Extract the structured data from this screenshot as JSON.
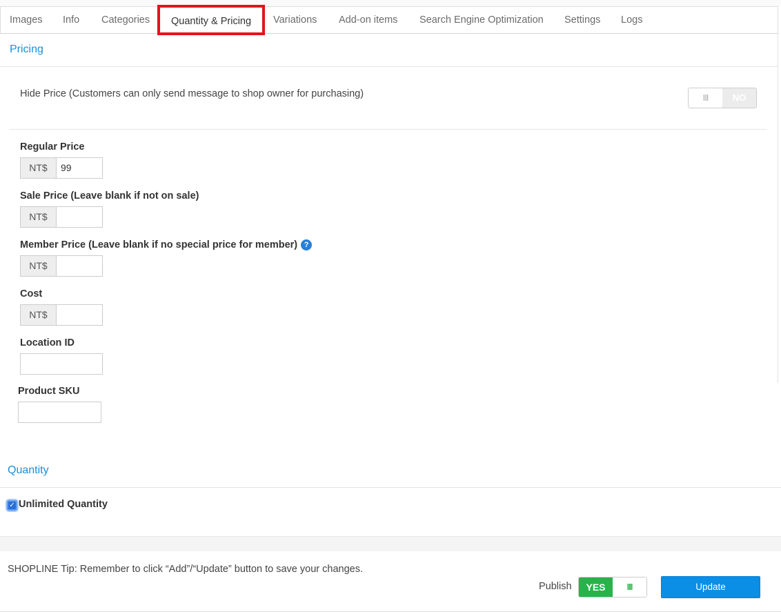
{
  "tabs": [
    {
      "label": "Images"
    },
    {
      "label": "Info"
    },
    {
      "label": "Categories"
    },
    {
      "label": "Quantity & Pricing"
    },
    {
      "label": "Variations"
    },
    {
      "label": "Add-on items"
    },
    {
      "label": "Search Engine Optimization"
    },
    {
      "label": "Settings"
    },
    {
      "label": "Logs"
    }
  ],
  "active_tab": "Quantity & Pricing",
  "pricing": {
    "title": "Pricing",
    "hide_price_label": "Hide Price (Customers can only send message to shop owner for purchasing)",
    "hide_price_toggle": {
      "grip": "III",
      "state": "NO"
    },
    "regular_price": {
      "label": "Regular Price",
      "currency": "NT$",
      "value": "99"
    },
    "sale_price": {
      "label": "Sale Price (Leave blank if not on sale)",
      "currency": "NT$",
      "value": ""
    },
    "member_price": {
      "label": "Member Price (Leave blank if no special price for member)",
      "currency": "NT$",
      "value": "",
      "help_icon": "question-circle-icon",
      "help_glyph": "?"
    },
    "cost": {
      "label": "Cost",
      "currency": "NT$",
      "value": ""
    },
    "location_id": {
      "label": "Location ID",
      "value": ""
    },
    "product_sku": {
      "label": "Product SKU",
      "value": ""
    }
  },
  "quantity": {
    "title": "Quantity",
    "unlimited_label": "Unlimited Quantity",
    "unlimited_checked": true,
    "check_glyph": "✓"
  },
  "footer": {
    "tip": "SHOPLINE Tip: Remember to click “Add”/“Update” button to save your changes.",
    "publish_label": "Publish",
    "publish_toggle": {
      "state": "YES",
      "grip": "III"
    },
    "update_label": "Update"
  },
  "colors": {
    "accent": "#1a8fd6",
    "active_tab_border": "#e3141a",
    "publish_green": "#27b34a",
    "update_blue": "#0a8ee6"
  }
}
